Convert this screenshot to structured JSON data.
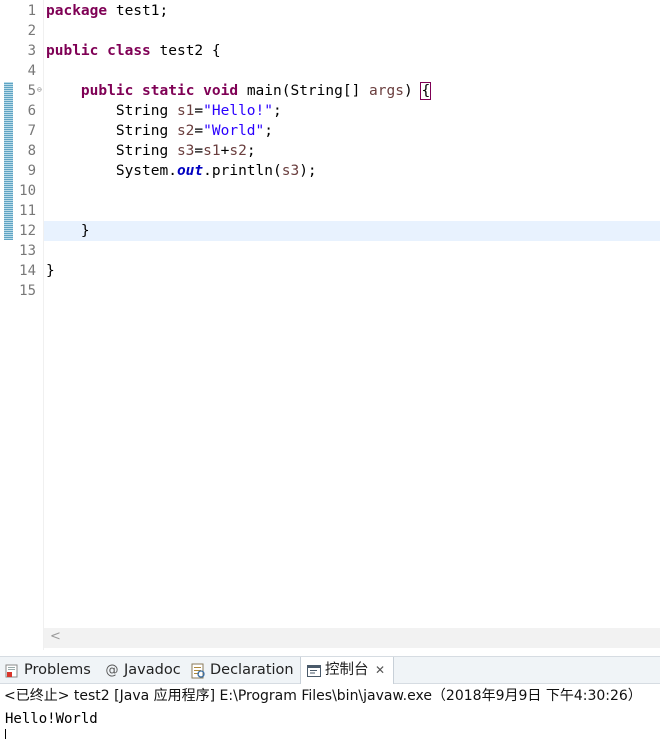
{
  "editor": {
    "lines": [
      {
        "num": "1"
      },
      {
        "num": "2"
      },
      {
        "num": "3"
      },
      {
        "num": "4"
      },
      {
        "num": "5"
      },
      {
        "num": "6"
      },
      {
        "num": "7"
      },
      {
        "num": "8"
      },
      {
        "num": "9"
      },
      {
        "num": "10"
      },
      {
        "num": "11"
      },
      {
        "num": "12"
      },
      {
        "num": "13"
      },
      {
        "num": "14"
      },
      {
        "num": "15"
      }
    ],
    "tokens": {
      "l1_kw": "package",
      "l1_rest": " test1;",
      "l3_kw1": "public",
      "l3_kw2": "class",
      "l3_rest": " test2 {",
      "l5_kw1": "public",
      "l5_kw2": "static",
      "l5_kw3": "void",
      "l5_mid": " main(String[] ",
      "l5_param": "args",
      "l5_close": ") ",
      "l5_brace": "{",
      "l6_type": "String ",
      "l6_var": "s1",
      "l6_eq": "=",
      "l6_str": "\"Hello!\"",
      "l6_end": ";",
      "l7_type": "String ",
      "l7_var": "s2",
      "l7_eq": "=",
      "l7_str": "\"World\"",
      "l7_end": ";",
      "l8_type": "String ",
      "l8_var": "s3",
      "l8_eq": "=",
      "l8_a": "s1",
      "l8_plus": "+",
      "l8_b": "s2",
      "l8_end": ";",
      "l9_sys": "System.",
      "l9_field": "out",
      "l9_call": ".println(",
      "l9_arg": "s3",
      "l9_end": ");",
      "l12_brace": "}",
      "l14_brace": "}"
    },
    "fold_marker": "⊖",
    "scroll_left_arrow": "<"
  },
  "view": {
    "tabs": [
      {
        "label": "Problems",
        "icon": "problems-icon"
      },
      {
        "label": "Javadoc",
        "icon": "javadoc-at-icon",
        "glyph": "@"
      },
      {
        "label": "Declaration",
        "icon": "declaration-icon"
      },
      {
        "label": "控制台",
        "icon": "console-icon",
        "close": "✕"
      }
    ],
    "console_header": "<已终止> test2 [Java 应用程序] E:\\Program Files\\bin\\javaw.exe（2018年9月9日 下午4:30:26）",
    "console_output": "Hello!World"
  }
}
